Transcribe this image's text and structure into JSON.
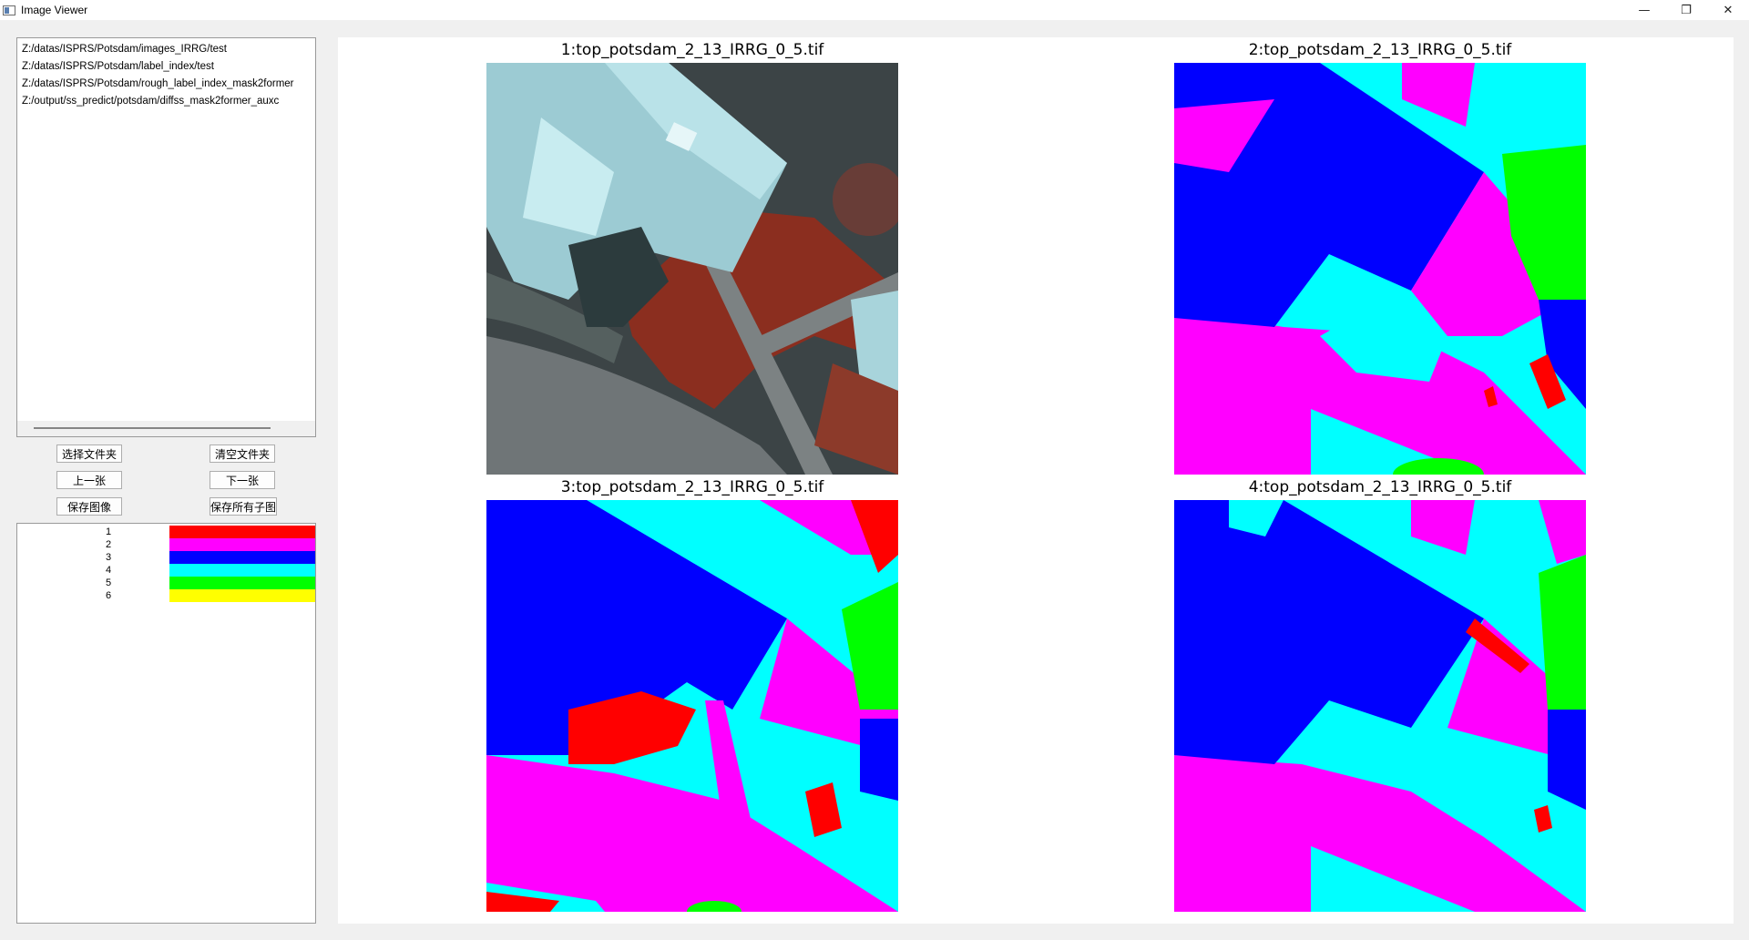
{
  "window": {
    "title": "Image Viewer",
    "controls": {
      "minimize": "—",
      "restore": "❐",
      "close": "✕"
    }
  },
  "folders": [
    "Z:/datas/ISPRS/Potsdam/images_IRRG/test",
    "Z:/datas/ISPRS/Potsdam/label_index/test",
    "Z:/datas/ISPRS/Potsdam/rough_label_index_mask2former",
    "Z:/output/ss_predict/potsdam/diffss_mask2former_auxc"
  ],
  "buttons": {
    "select_folder": "选择文件夹",
    "clear_folder": "清空文件夹",
    "prev": "上一张",
    "next": "下一张",
    "save_image": "保存图像",
    "save_all": "保存所有子图"
  },
  "legend": [
    {
      "label": "1",
      "color": "#ff0000"
    },
    {
      "label": "2",
      "color": "#ff00ff"
    },
    {
      "label": "3",
      "color": "#0000ff"
    },
    {
      "label": "4",
      "color": "#00ffff"
    },
    {
      "label": "5",
      "color": "#00ff00"
    },
    {
      "label": "6",
      "color": "#ffff00"
    }
  ],
  "panels": [
    {
      "title": "1:top_potsdam_2_13_IRRG_0_5.tif",
      "kind": "aerial-photo"
    },
    {
      "title": "2:top_potsdam_2_13_IRRG_0_5.tif",
      "kind": "label-map"
    },
    {
      "title": "3:top_potsdam_2_13_IRRG_0_5.tif",
      "kind": "label-map"
    },
    {
      "title": "4:top_potsdam_2_13_IRRG_0_5.tif",
      "kind": "label-map"
    }
  ]
}
